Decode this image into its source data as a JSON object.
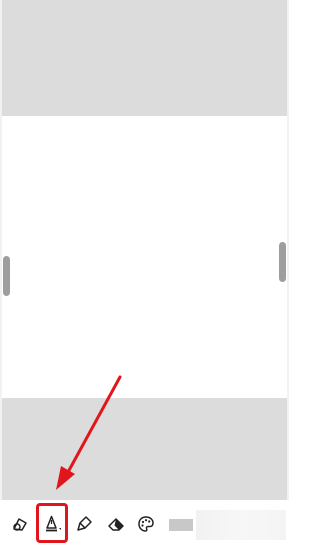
{
  "colors": {
    "gray_band": "#dcdcdc",
    "page": "#ffffff",
    "handle": "#9e9e9e",
    "annotation_red": "#e0161c",
    "swatch": "#c8c8c8"
  },
  "toolbar": {
    "tools": [
      {
        "name": "lasso-tool",
        "icon": "lasso-icon"
      },
      {
        "name": "pen-tool",
        "icon": "pen-icon",
        "selected": true
      },
      {
        "name": "highlighter-tool",
        "icon": "highlighter-icon"
      },
      {
        "name": "eraser-tool",
        "icon": "eraser-icon"
      },
      {
        "name": "color-palette-tool",
        "icon": "palette-icon"
      }
    ]
  }
}
